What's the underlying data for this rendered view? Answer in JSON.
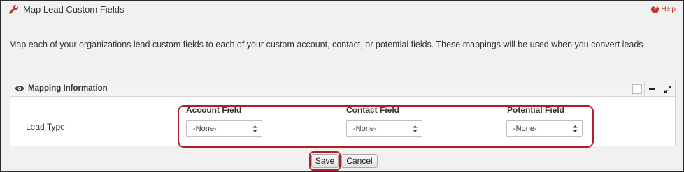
{
  "header": {
    "title": "Map Lead Custom Fields",
    "help_label": "Help",
    "help_glyph": "?"
  },
  "description": "Map each of your organizations lead custom fields to each of your custom account, contact, or potential fields. These mappings will be used when you convert leads",
  "panel": {
    "title": "Mapping Information",
    "row_label": "Lead Type",
    "columns": [
      {
        "label": "Account Field",
        "selected": "-None-"
      },
      {
        "label": "Contact Field",
        "selected": "-None-"
      },
      {
        "label": "Potential Field",
        "selected": "-None-"
      }
    ]
  },
  "actions": {
    "save_label": "Save",
    "cancel_label": "Cancel"
  },
  "colors": {
    "accent_red": "#b01e2a",
    "help_red": "#c0392b",
    "wrench": "#c0392b"
  }
}
